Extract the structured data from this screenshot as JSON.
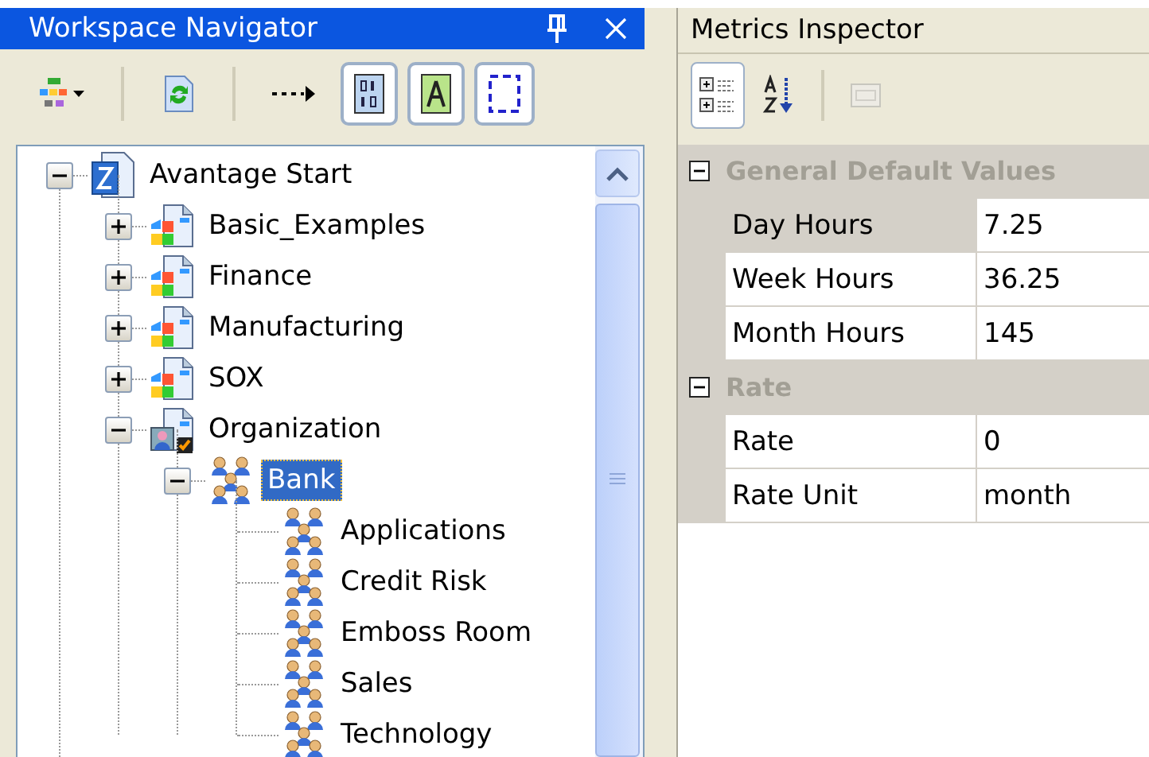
{
  "navigator": {
    "title": "Workspace Navigator",
    "toolbar": [
      {
        "kind": "layout-menu"
      },
      {
        "kind": "separator"
      },
      {
        "kind": "refresh"
      },
      {
        "kind": "separator"
      },
      {
        "kind": "connector"
      },
      {
        "kind": "binary",
        "checked": true
      },
      {
        "kind": "text-frame",
        "checked": true
      },
      {
        "kind": "selection",
        "checked": true
      }
    ],
    "tree": [
      {
        "label": "Avantage Start",
        "kind": "start",
        "expanded": true,
        "selected": false,
        "children": [
          {
            "label": "Basic_Examples",
            "kind": "project",
            "expanded": false,
            "selected": false
          },
          {
            "label": "Finance",
            "kind": "project",
            "expanded": false,
            "selected": false
          },
          {
            "label": "Manufacturing",
            "kind": "project",
            "expanded": false,
            "selected": false
          },
          {
            "label": "SOX",
            "kind": "project",
            "expanded": false,
            "selected": false
          },
          {
            "label": "Organization",
            "kind": "organization",
            "expanded": true,
            "selected": false,
            "children": [
              {
                "label": "Bank",
                "kind": "group",
                "expanded": true,
                "selected": true,
                "children": [
                  {
                    "label": "Applications",
                    "kind": "group",
                    "selected": false
                  },
                  {
                    "label": "Credit Risk",
                    "kind": "group",
                    "selected": false
                  },
                  {
                    "label": "Emboss Room",
                    "kind": "group",
                    "selected": false
                  },
                  {
                    "label": "Sales",
                    "kind": "group",
                    "selected": false
                  },
                  {
                    "label": "Technology",
                    "kind": "group",
                    "selected": false
                  }
                ]
              }
            ]
          }
        ]
      }
    ]
  },
  "inspector": {
    "title": "Metrics Inspector",
    "toolbar": [
      {
        "kind": "categorized",
        "checked": true,
        "disabled": false
      },
      {
        "kind": "alphabetical",
        "checked": false,
        "disabled": false
      },
      {
        "kind": "separator"
      },
      {
        "kind": "property-pages",
        "checked": false,
        "disabled": true
      }
    ],
    "categories": [
      {
        "name": "General Default Values",
        "expanded": true,
        "properties": [
          {
            "name": "Day Hours",
            "value": "7.25",
            "selected": true
          },
          {
            "name": "Week Hours",
            "value": "36.25",
            "selected": false
          },
          {
            "name": "Month Hours",
            "value": "145",
            "selected": false
          }
        ]
      },
      {
        "name": "Rate",
        "expanded": true,
        "properties": [
          {
            "name": "Rate",
            "value": "0",
            "selected": false
          },
          {
            "name": "Rate Unit",
            "value": "month",
            "selected": false
          }
        ]
      }
    ]
  }
}
